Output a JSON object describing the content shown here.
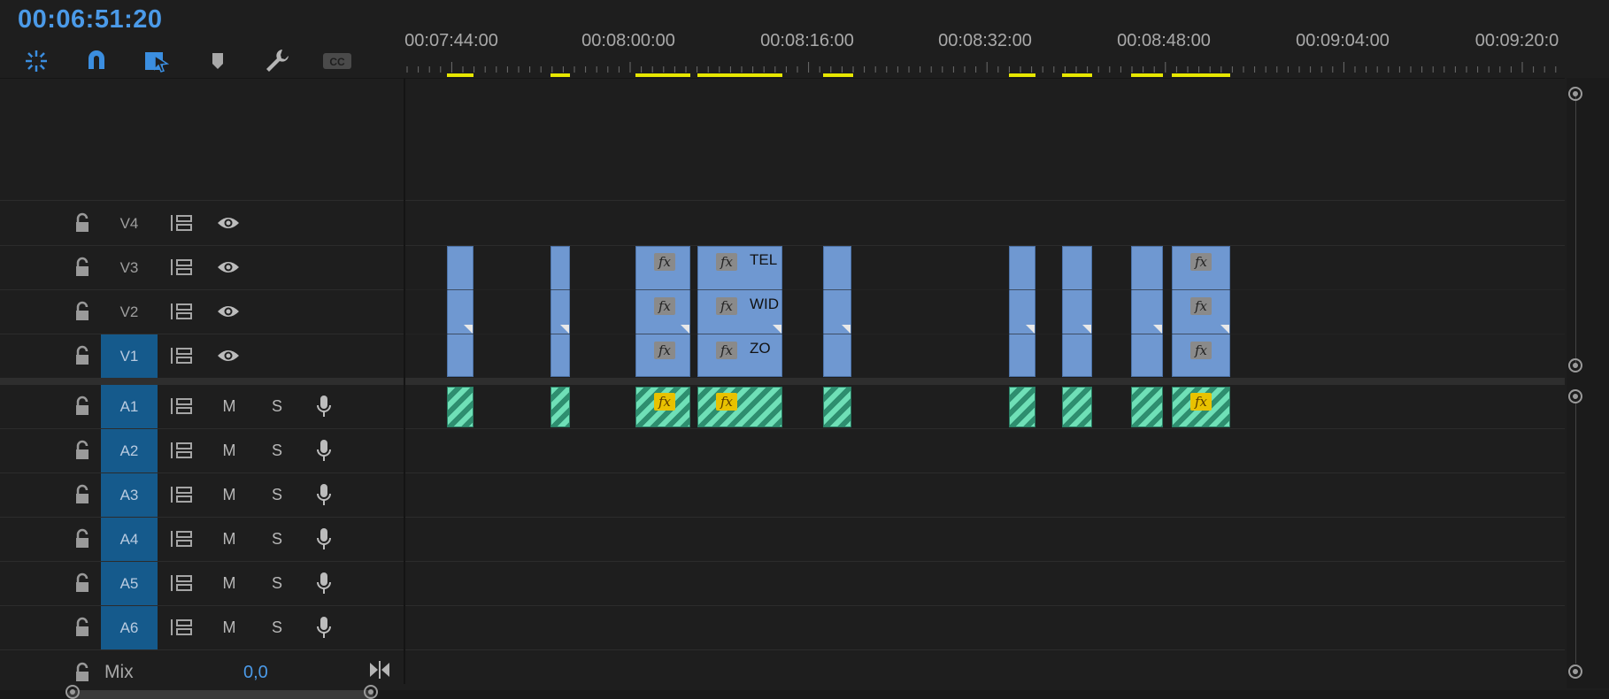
{
  "timecode": "00:06:51:20",
  "toolbar": {
    "tools": [
      {
        "name": "insert-overwrite-icon",
        "active": true
      },
      {
        "name": "snap-magnet-icon",
        "active": true
      },
      {
        "name": "linked-selection-icon",
        "active": true
      },
      {
        "name": "add-marker-icon",
        "active": false
      },
      {
        "name": "wrench-settings-icon",
        "active": false
      },
      {
        "name": "captions-cc-icon",
        "active": false
      }
    ]
  },
  "ruler": {
    "labels": [
      "00:07:44:00",
      "00:08:00:00",
      "00:08:16:00",
      "00:08:32:00",
      "00:08:48:00",
      "00:09:04:00",
      "00:09:20:0"
    ],
    "marker_color": "#e6e600"
  },
  "video_tracks": [
    {
      "name": "V4",
      "targeted": false
    },
    {
      "name": "V3",
      "targeted": false
    },
    {
      "name": "V2",
      "targeted": false
    },
    {
      "name": "V1",
      "targeted": true
    }
  ],
  "audio_tracks": [
    {
      "name": "A1",
      "targeted": true,
      "mute": "M",
      "solo": "S"
    },
    {
      "name": "A2",
      "targeted": true,
      "mute": "M",
      "solo": "S"
    },
    {
      "name": "A3",
      "targeted": true,
      "mute": "M",
      "solo": "S"
    },
    {
      "name": "A4",
      "targeted": true,
      "mute": "M",
      "solo": "S"
    },
    {
      "name": "A5",
      "targeted": true,
      "mute": "M",
      "solo": "S"
    },
    {
      "name": "A6",
      "targeted": true,
      "mute": "M",
      "solo": "S"
    }
  ],
  "clip_labels": {
    "v3": "TEL",
    "v2": "WID",
    "v1": "ZO"
  },
  "fx_label": "fx",
  "mix": {
    "label": "Mix",
    "value": "0,0"
  },
  "colors": {
    "accent": "#4b9ae8",
    "video_clip": "#6f98d1",
    "audio_clip": "#6fe0b7",
    "target": "#155a8c",
    "fx_badge": "#e8c200"
  }
}
